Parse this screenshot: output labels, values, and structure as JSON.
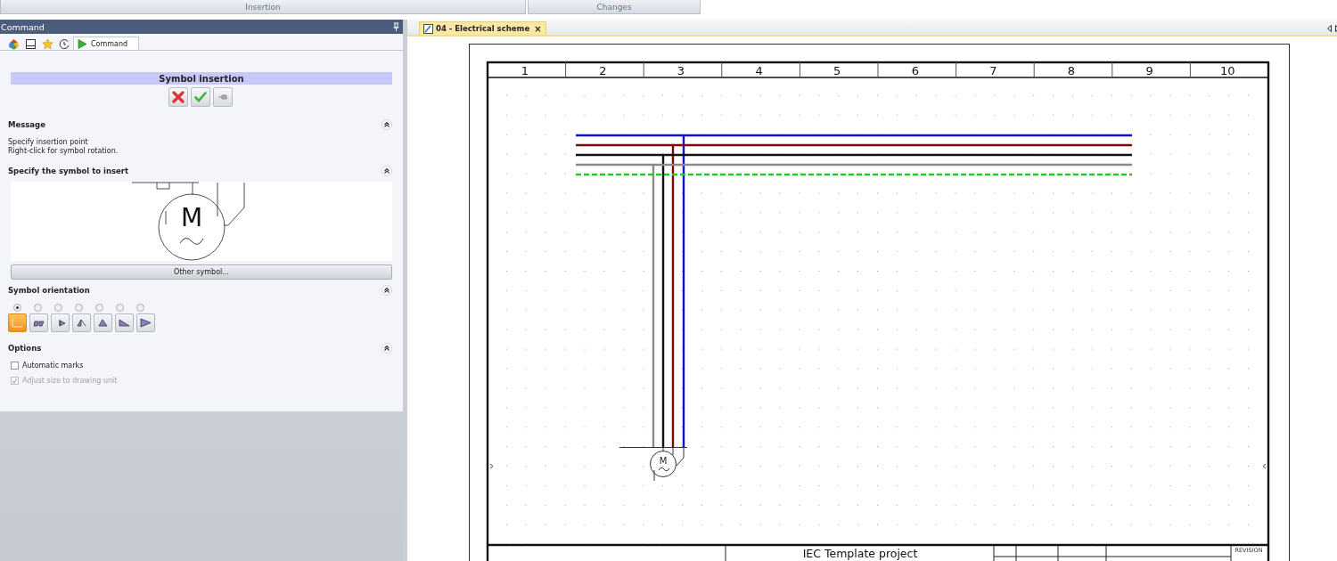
{
  "ribbon": {
    "groups": [
      "Insertion",
      "Changes"
    ]
  },
  "panel": {
    "title": "Command",
    "tabs": [
      {
        "kind": "components",
        "selected": false
      },
      {
        "kind": "sheet",
        "selected": false
      },
      {
        "kind": "favorites",
        "selected": false
      },
      {
        "kind": "history",
        "selected": false
      },
      {
        "kind": "command",
        "label": "Command",
        "selected": true
      }
    ],
    "heading": "Symbol insertion",
    "actions": [
      {
        "kind": "cancel"
      },
      {
        "kind": "confirm"
      },
      {
        "kind": "pin"
      }
    ],
    "sections": [
      {
        "kind": "message",
        "title": "Message",
        "expanded": true,
        "lines": [
          "Specify insertion point",
          "Right-click for symbol rotation."
        ]
      },
      {
        "kind": "symbol",
        "title": "Specify the symbol to insert",
        "expanded": true,
        "symbol_letter": "M",
        "button": "Other symbol..."
      },
      {
        "kind": "orientation",
        "title": "Symbol orientation",
        "expanded": true,
        "options": [
          {
            "selected": true
          },
          {
            "selected": false
          },
          {
            "selected": false
          },
          {
            "selected": false
          },
          {
            "selected": false
          },
          {
            "selected": false
          },
          {
            "selected": false
          }
        ]
      },
      {
        "kind": "options",
        "title": "Options",
        "expanded": true,
        "checkboxes": [
          {
            "label": "Automatic marks",
            "checked": false,
            "disabled": false
          },
          {
            "label": "Adjust size to drawing unit",
            "checked": true,
            "disabled": true
          }
        ]
      }
    ]
  },
  "document": {
    "tab": {
      "label": "04 - Electrical scheme",
      "close": "×",
      "selected": true
    },
    "sheet": {
      "columns": [
        "1",
        "2",
        "3",
        "4",
        "5",
        "6",
        "7",
        "8",
        "9",
        "10"
      ],
      "motor_label": "M",
      "title_block": {
        "project": "IEC Template project",
        "revision_label": "REVISION"
      }
    }
  }
}
